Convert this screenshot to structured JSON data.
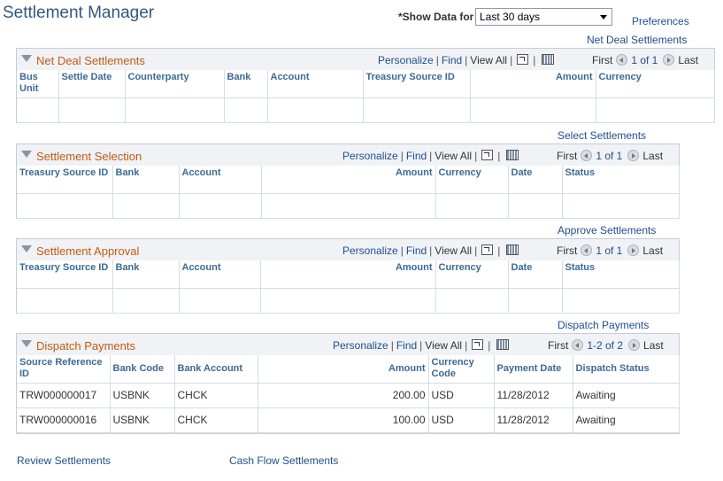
{
  "page": {
    "title": "Settlement Manager",
    "show_data_label": "*Show Data for",
    "show_data_value": "Last 30 days",
    "preferences_link": "Preferences"
  },
  "sections": {
    "net": {
      "top_link": "Net Deal Settlements",
      "title": "Net Deal Settlements",
      "personalize": "Personalize",
      "find": "Find",
      "view_all": "View All",
      "first": "First",
      "count": "1 of 1",
      "last": "Last",
      "columns": [
        "Bus Unit",
        "Settle Date",
        "Counterparty",
        "Bank",
        "Account",
        "Treasury Source ID",
        "Amount",
        "Currency"
      ]
    },
    "selection": {
      "top_link": "Select Settlements",
      "title": "Settlement Selection",
      "personalize": "Personalize",
      "find": "Find",
      "view_all": "View All",
      "first": "First",
      "count": "1 of 1",
      "last": "Last",
      "columns": [
        "Treasury Source ID",
        "Bank",
        "Account",
        "Amount",
        "Currency",
        "Date",
        "Status"
      ]
    },
    "approval": {
      "top_link": "Approve Settlements",
      "title": "Settlement Approval",
      "personalize": "Personalize",
      "find": "Find",
      "view_all": "View All",
      "first": "First",
      "count": "1 of 1",
      "last": "Last",
      "columns": [
        "Treasury Source ID",
        "Bank",
        "Account",
        "Amount",
        "Currency",
        "Date",
        "Status"
      ]
    },
    "dispatch": {
      "top_link": "Dispatch Payments",
      "title": "Dispatch Payments",
      "personalize": "Personalize",
      "find": "Find",
      "view_all": "View All",
      "first": "First",
      "count": "1-2 of 2",
      "last": "Last",
      "columns": [
        "Source Reference ID",
        "Bank Code",
        "Bank Account",
        "Amount",
        "Currency Code",
        "Payment Date",
        "Dispatch Status"
      ],
      "rows": [
        {
          "ref": "TRW000000017",
          "bank_code": "USBNK",
          "bank_account": "CHCK",
          "amount": "200.00",
          "currency": "USD",
          "date": "11/28/2012",
          "status": "Awaiting"
        },
        {
          "ref": "TRW000000016",
          "bank_code": "USBNK",
          "bank_account": "CHCK",
          "amount": "100.00",
          "currency": "USD",
          "date": "11/28/2012",
          "status": "Awaiting"
        }
      ]
    }
  },
  "footer": {
    "review_link": "Review Settlements",
    "cashflow_link": "Cash Flow Settlements"
  },
  "icons": {
    "collapse": "collapse-triangle-icon",
    "zoom": "new-window-icon",
    "download": "download-spreadsheet-icon",
    "prev": "previous-arrow-icon",
    "next": "next-arrow-icon"
  }
}
